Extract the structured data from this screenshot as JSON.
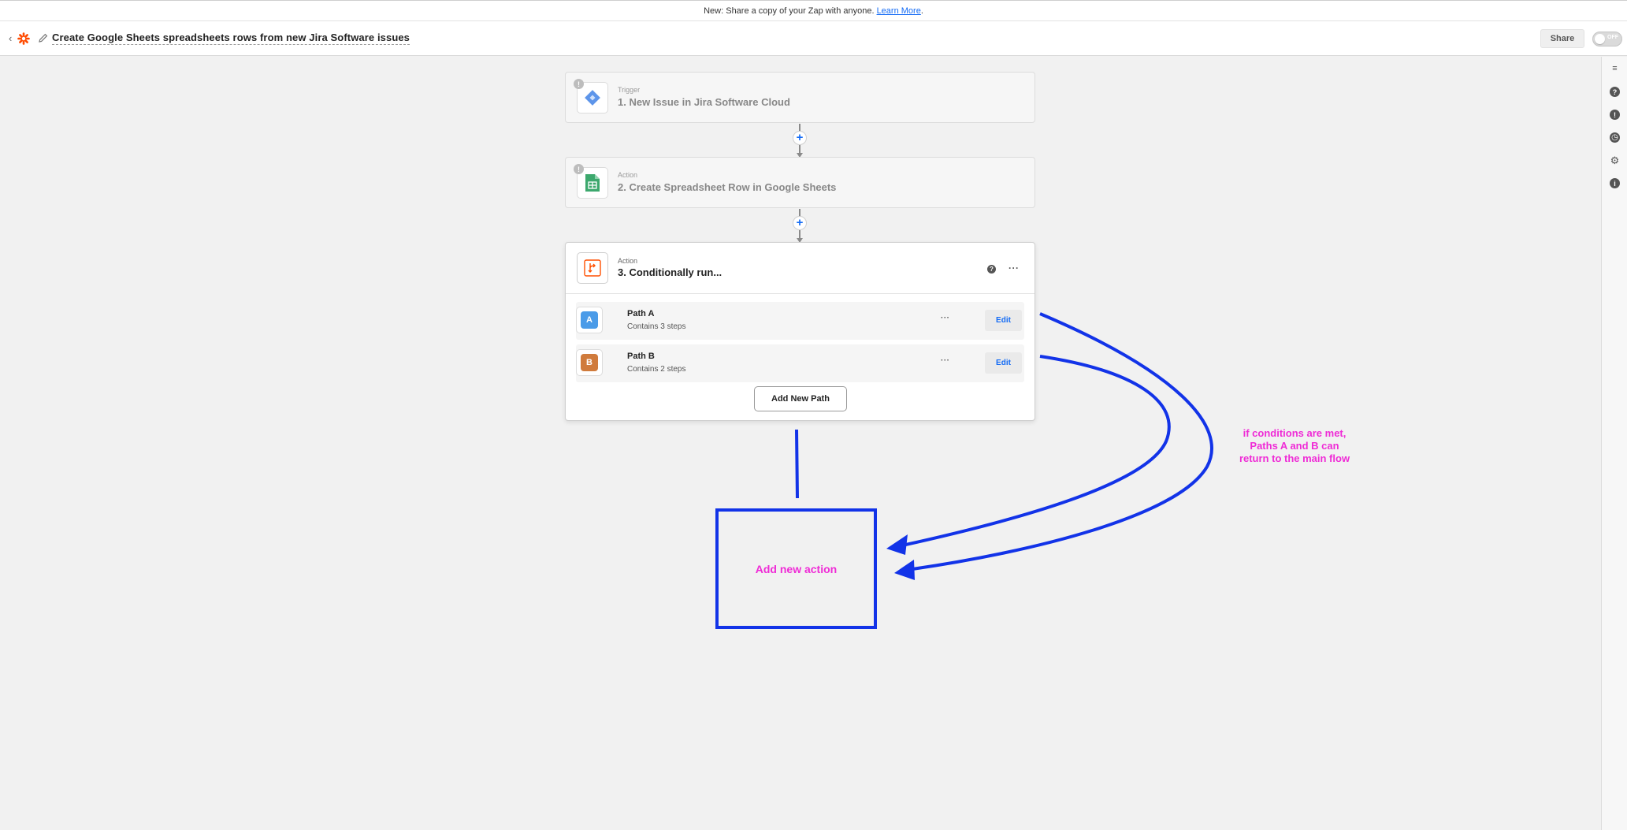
{
  "announcement": {
    "text": "New: Share a copy of your Zap with anyone.",
    "link": "Learn More",
    "tail": "."
  },
  "header": {
    "title": "Create Google Sheets spreadsheets rows from new Jira Software issues",
    "share_label": "Share",
    "toggle_label": "OFF",
    "back_icon": "chevron-left-icon",
    "logo_icon": "zapier-logo-icon",
    "edit_icon": "pencil-icon"
  },
  "steps": [
    {
      "kind": "Trigger",
      "title": "1. New Issue in Jira Software Cloud",
      "warning": "!",
      "icon": "jira-icon"
    },
    {
      "kind": "Action",
      "title": "2. Create Spreadsheet Row in Google Sheets",
      "warning": "!",
      "icon": "google-sheets-icon"
    }
  ],
  "add_step_symbol": "+",
  "paths_step": {
    "kind": "Action",
    "title": "3. Conditionally run...",
    "help": "?",
    "more": "···",
    "icon": "paths-icon",
    "paths": [
      {
        "letter": "A",
        "name": "Path A",
        "subtitle": "Contains 3 steps",
        "edit_label": "Edit",
        "more": "···",
        "color": "#4a9be8"
      },
      {
        "letter": "B",
        "name": "Path B",
        "subtitle": "Contains 2 steps",
        "edit_label": "Edit",
        "more": "···",
        "color": "#d07b3c"
      }
    ],
    "add_path_label": "Add New Path"
  },
  "annotation": {
    "box_label": "Add new action",
    "note": "if conditions are met, Paths A and B can return to the main flow",
    "note_lines": [
      "if conditions are met,",
      "Paths A and B can",
      "return to the main flow"
    ],
    "stroke_color": "#1233e8",
    "text_color": "#ef2bd6"
  },
  "right_rail": {
    "icons": [
      "notes-icon",
      "help-icon",
      "info-icon",
      "history-icon",
      "settings-icon",
      "details-icon"
    ],
    "glyphs": [
      "≡",
      "?",
      "!",
      "◷",
      "⚙",
      "i"
    ]
  }
}
